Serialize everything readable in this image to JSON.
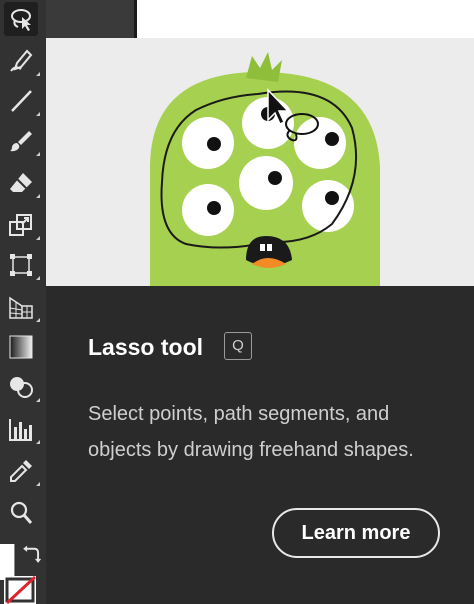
{
  "tooltip": {
    "title": "Lasso tool",
    "shortcut": "Q",
    "description": "Select points, path segments, and objects by drawing freehand shapes.",
    "learn_more_label": "Learn more"
  },
  "colors": {
    "toolbar_bg": "#323232",
    "tooltip_bg": "#2a2a2a",
    "illustration_bg": "#ececec",
    "monster_green": "#a6d04f",
    "mouth_orange": "#f28a26"
  },
  "toolbar": {
    "tools": [
      {
        "icon": "lasso-icon",
        "active": true
      },
      {
        "icon": "curvature-pen-icon"
      },
      {
        "icon": "line-segment-icon"
      },
      {
        "icon": "paintbrush-icon"
      },
      {
        "icon": "eraser-icon"
      },
      {
        "icon": "scale-icon"
      },
      {
        "icon": "free-transform-icon"
      },
      {
        "icon": "perspective-grid-icon"
      },
      {
        "icon": "gradient-icon"
      },
      {
        "icon": "shape-builder-icon"
      },
      {
        "icon": "bar-graph-icon"
      },
      {
        "icon": "eyedropper-icon"
      },
      {
        "icon": "zoom-icon"
      },
      {
        "icon": "swap-fill-stroke-icon"
      },
      {
        "icon": "stroke-none-icon"
      }
    ]
  }
}
